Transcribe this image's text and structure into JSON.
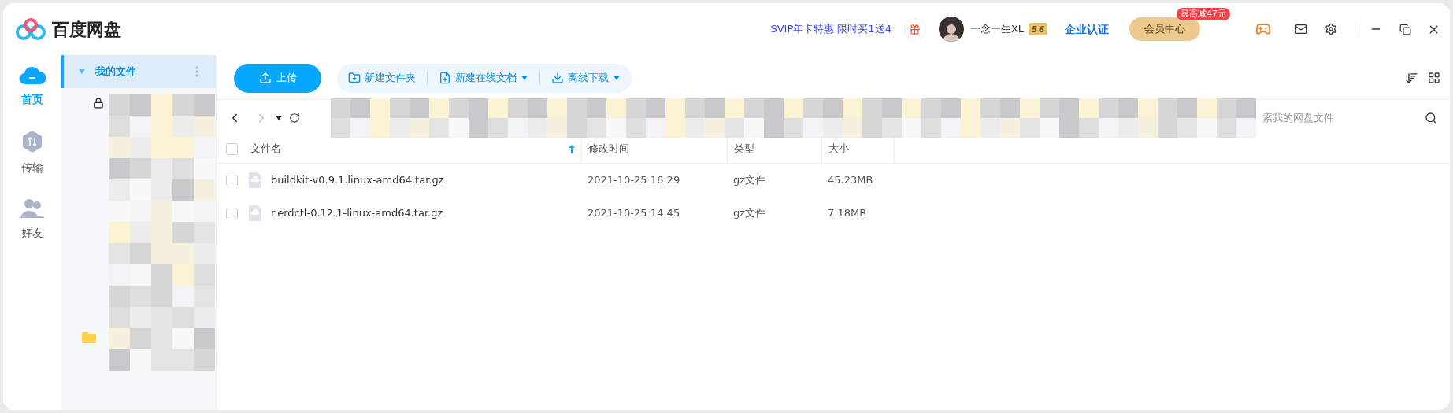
{
  "app": {
    "name": "百度网盘"
  },
  "promo": "SVIP年卡特惠 限时买1送4",
  "user": {
    "name": "一念一生XL",
    "badge_1": "5",
    "badge_2": "6"
  },
  "enterprise": "企业认证",
  "vip_center": {
    "label": "会员中心",
    "tag": "最高减47元"
  },
  "rail": [
    {
      "kind": "home",
      "label": "首页",
      "selected": true
    },
    {
      "kind": "transfer",
      "label": "传输",
      "selected": false
    },
    {
      "kind": "friends",
      "label": "好友",
      "selected": false
    }
  ],
  "tree": [
    {
      "label": "我的文件",
      "selected": true,
      "expanded": true
    }
  ],
  "toolbar": {
    "upload": "上传",
    "actions": [
      {
        "kind": "folder",
        "label": "新建文件夹",
        "dropdown": false
      },
      {
        "kind": "doc",
        "label": "新建在线文档",
        "dropdown": true
      },
      {
        "kind": "download",
        "label": "离线下载",
        "dropdown": true
      }
    ]
  },
  "search": {
    "placeholder": "索我的网盘文件"
  },
  "table": {
    "all_checked": false,
    "columns": [
      {
        "label": "文件名",
        "sorted": true
      },
      {
        "label": "修改时间",
        "sorted": false
      },
      {
        "label": "类型",
        "sorted": false
      },
      {
        "label": "大小",
        "sorted": false
      }
    ],
    "rows": [
      {
        "name": "buildkit-v0.9.1.linux-amd64.tar.gz",
        "modified": "2021-10-25 16:29",
        "type": "gz文件",
        "size": "45.23MB",
        "checked": false
      },
      {
        "name": "nerdctl-0.12.1-linux-amd64.tar.gz",
        "modified": "2021-10-25 14:45",
        "type": "gz文件",
        "size": "7.18MB",
        "checked": false
      }
    ]
  }
}
